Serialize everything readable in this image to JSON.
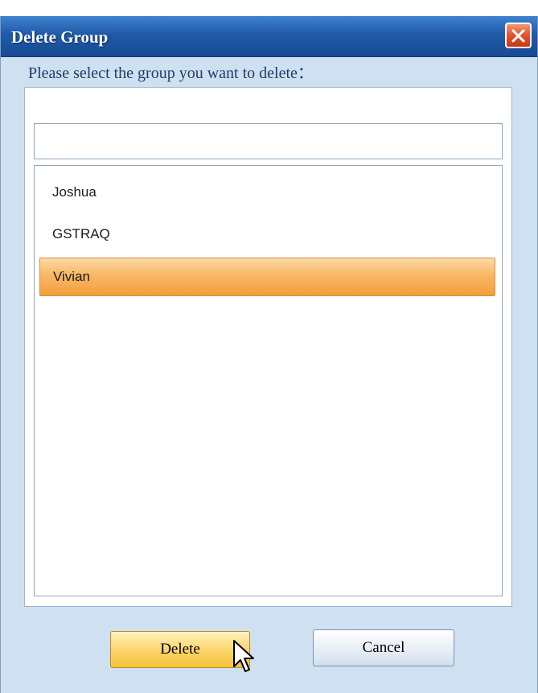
{
  "window": {
    "title": "Delete Group",
    "prompt": "Please select the group you want to delete："
  },
  "search": {
    "value": "",
    "placeholder": ""
  },
  "groups": [
    {
      "label": "Joshua",
      "selected": false
    },
    {
      "label": "GSTRAQ",
      "selected": false
    },
    {
      "label": "Vivian",
      "selected": true
    }
  ],
  "buttons": {
    "delete_label": "Delete",
    "cancel_label": "Cancel"
  },
  "icons": {
    "close": "close-icon",
    "cursor": "mouse-pointer-icon"
  },
  "colors": {
    "titlebar": "#1f5aa8",
    "selection": "#f8b865",
    "close_button": "#e2582f"
  }
}
